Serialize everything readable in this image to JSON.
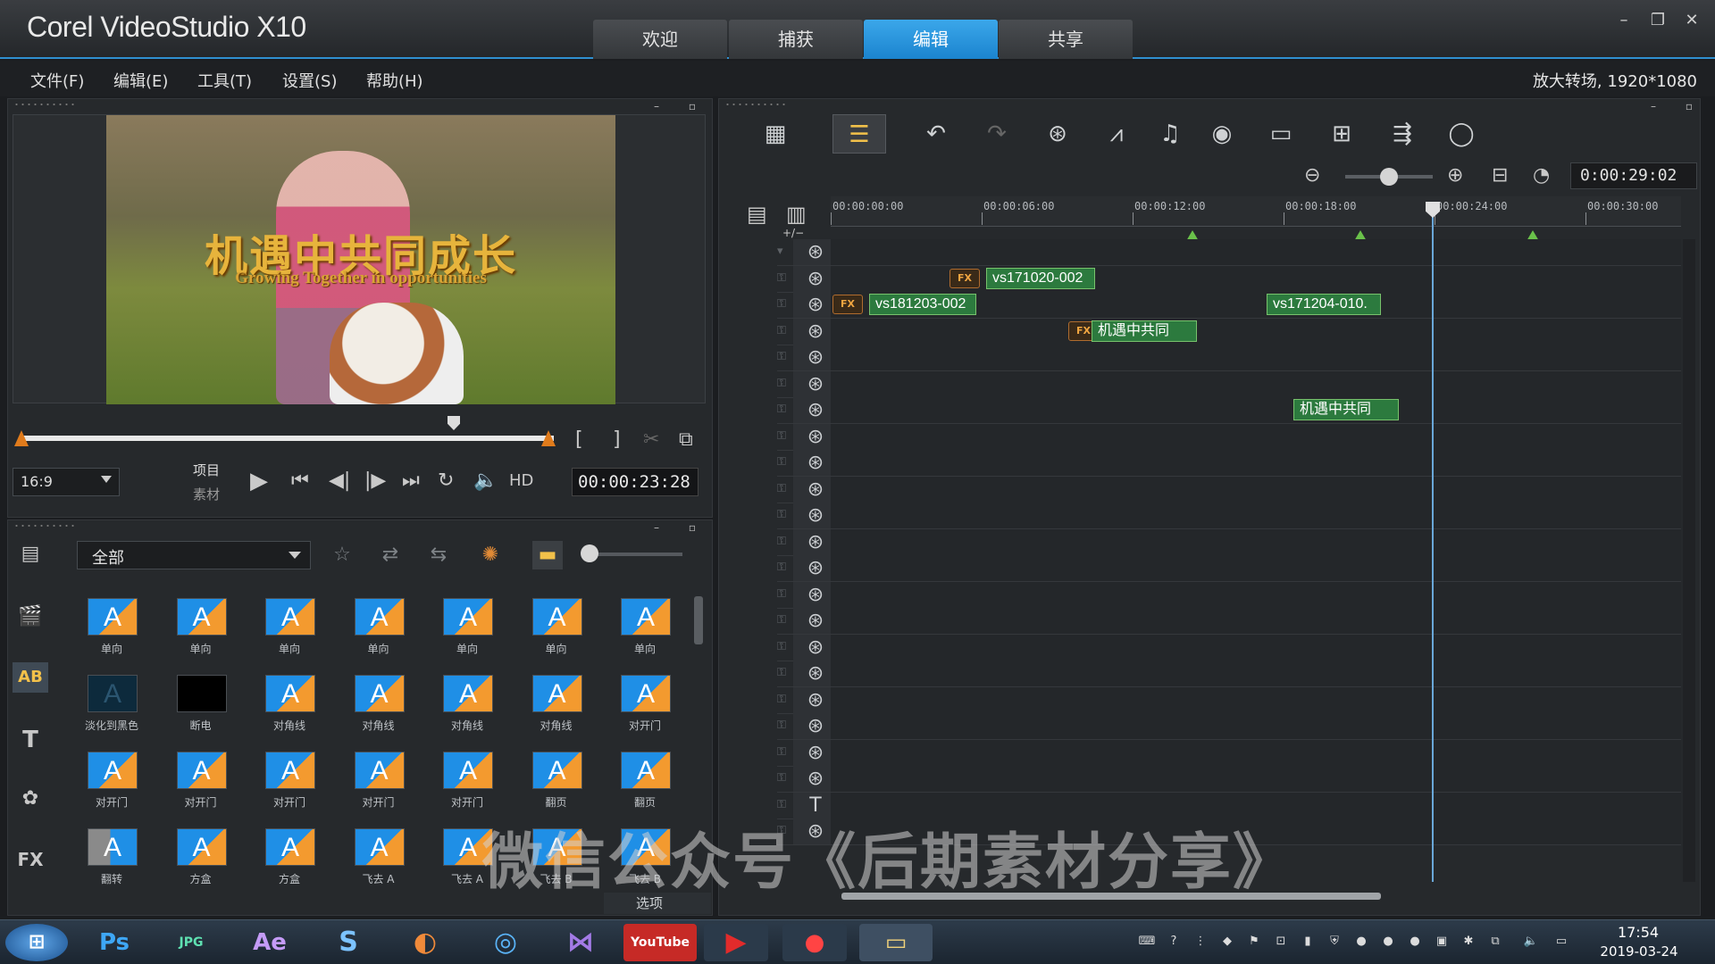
{
  "app": {
    "title": "Corel VideoStudio X10"
  },
  "tabs": [
    {
      "label": "欢迎"
    },
    {
      "label": "捕获"
    },
    {
      "label": "编辑",
      "active": true
    },
    {
      "label": "共享"
    }
  ],
  "window_controls": {
    "minimize": "–",
    "restore": "❐",
    "close": "✕"
  },
  "menu": [
    {
      "label": "文件(F)"
    },
    {
      "label": "编辑(E)"
    },
    {
      "label": "工具(T)"
    },
    {
      "label": "设置(S)"
    },
    {
      "label": "帮助(H)"
    }
  ],
  "project_info": "放大转场, 1920*1080",
  "preview": {
    "title": "机遇中共同成长",
    "subtitle": "Growing Together in opportunities",
    "aspect_ratio": "16:9",
    "mode_project": "项目",
    "mode_clip": "素材",
    "hd_label": "HD",
    "timecode": "00:00:23:28"
  },
  "library": {
    "filter_value": "全部",
    "sidebar_icons": [
      "media-icon",
      "instant-project-icon",
      "transition-icon",
      "title-icon",
      "graphics-icon",
      "filter-fx-icon"
    ],
    "sidebar_labels": {
      "transition": "AB",
      "title": "T",
      "fx": "FX"
    },
    "options_label": "选项",
    "thumbnails": [
      {
        "caption": "单向",
        "style": "normal"
      },
      {
        "caption": "单向",
        "style": "normal"
      },
      {
        "caption": "单向",
        "style": "normal"
      },
      {
        "caption": "单向",
        "style": "normal"
      },
      {
        "caption": "单向",
        "style": "normal"
      },
      {
        "caption": "单向",
        "style": "normal"
      },
      {
        "caption": "单向",
        "style": "normal"
      },
      {
        "caption": "淡化到黑色",
        "style": "dark"
      },
      {
        "caption": "断电",
        "style": "black"
      },
      {
        "caption": "对角线",
        "style": "normal"
      },
      {
        "caption": "对角线",
        "style": "normal"
      },
      {
        "caption": "对角线",
        "style": "normal"
      },
      {
        "caption": "对角线",
        "style": "normal"
      },
      {
        "caption": "对开门",
        "style": "normal"
      },
      {
        "caption": "对开门",
        "style": "normal"
      },
      {
        "caption": "对开门",
        "style": "normal"
      },
      {
        "caption": "对开门",
        "style": "normal"
      },
      {
        "caption": "对开门",
        "style": "normal"
      },
      {
        "caption": "对开门",
        "style": "normal"
      },
      {
        "caption": "翻页",
        "style": "normal"
      },
      {
        "caption": "翻页",
        "style": "normal"
      },
      {
        "caption": "翻转",
        "style": "gray"
      },
      {
        "caption": "方盒",
        "style": "normal"
      },
      {
        "caption": "方盒",
        "style": "normal"
      },
      {
        "caption": "飞去 A",
        "style": "normal"
      },
      {
        "caption": "飞去 A",
        "style": "normal"
      },
      {
        "caption": "飞去 B",
        "style": "normal"
      },
      {
        "caption": "飞去 B",
        "style": "normal"
      }
    ],
    "thumb_glyph": "A"
  },
  "timeline": {
    "duration": "0:00:29:02",
    "ruler_labels": [
      "00:00:00:00",
      "00:00:06:00",
      "00:00:12:00",
      "00:00:18:00",
      "00:00:24:00",
      "00:00:30:00"
    ],
    "add_track_label": "+/−",
    "clips": [
      {
        "label": "vs171020-002"
      },
      {
        "label": "vs181203-002"
      },
      {
        "label": "vs171204-010."
      },
      {
        "label": "机遇中共同"
      },
      {
        "label": "机遇中共同"
      }
    ],
    "fx_label": "FX"
  },
  "watermark": "微信公众号《后期素材分享》",
  "taskbar": {
    "apps": [
      {
        "name": "start-button",
        "label": ""
      },
      {
        "name": "photoshop",
        "label": "Ps"
      },
      {
        "name": "jpg-viewer",
        "label": "JPG"
      },
      {
        "name": "after-effects",
        "label": "Ae"
      },
      {
        "name": "sogou",
        "label": "S"
      },
      {
        "name": "app-5",
        "label": ""
      },
      {
        "name": "browser",
        "label": ""
      },
      {
        "name": "visual-studio",
        "label": ""
      },
      {
        "name": "youtube",
        "label": "YouTube"
      },
      {
        "name": "player",
        "label": ""
      },
      {
        "name": "recorder",
        "label": ""
      },
      {
        "name": "explorer",
        "label": ""
      }
    ],
    "time": "17:54",
    "date": "2019-03-24"
  },
  "colors": {
    "accent": "#1b84cf",
    "clip_green": "#2c7a3e",
    "marker_green": "#6ac14a",
    "title_gold": "#e7b43c"
  }
}
